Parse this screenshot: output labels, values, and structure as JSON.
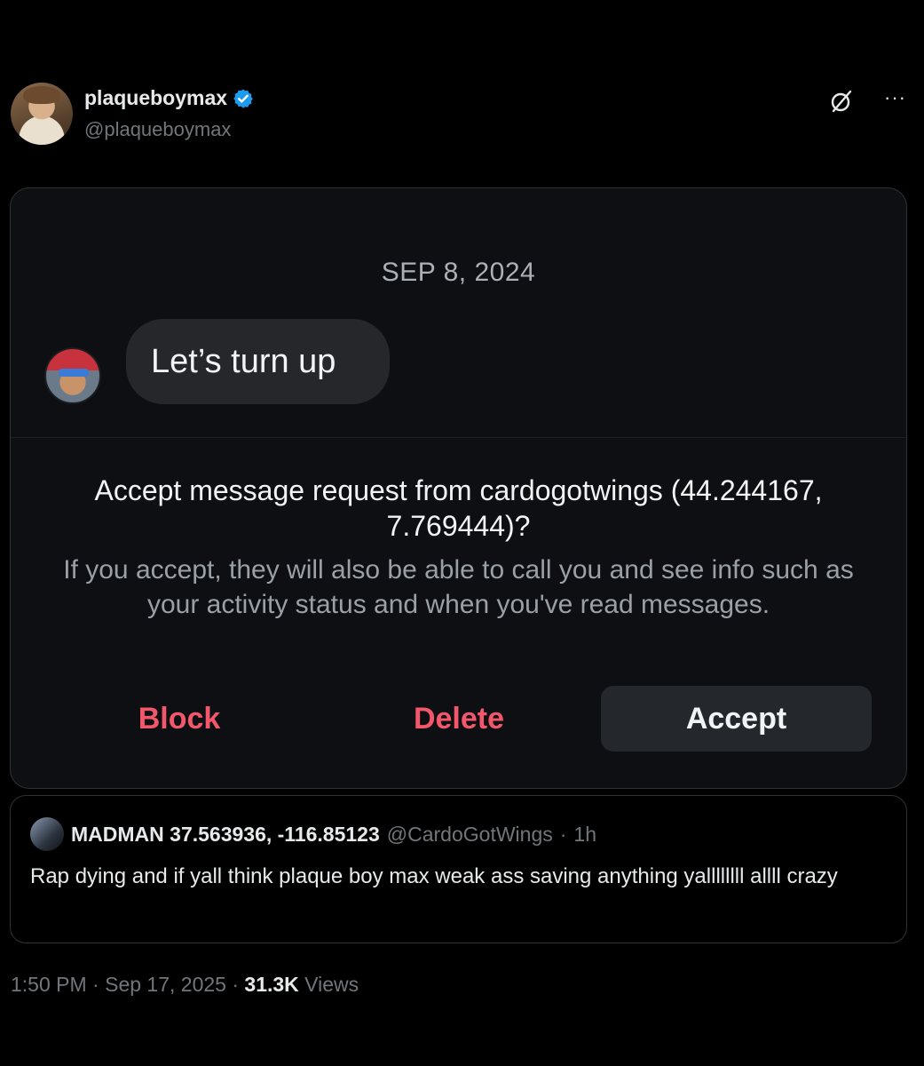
{
  "author": {
    "display_name": "plaqueboymax",
    "handle": "@plaqueboymax",
    "verified_icon": "verified-badge-icon",
    "verified_color": "#1d9bf0"
  },
  "actions": {
    "grok_icon": "grok-icon",
    "more_label": "···"
  },
  "screenshot": {
    "date": "SEP 8, 2024",
    "message": "Let’s turn up",
    "request_title": "Accept message request from cardogotwings (44.244167, 7.769444)?",
    "request_body": "If you accept, they will also be able to call you and see info such as your activity status and when you've read messages.",
    "block_label": "Block",
    "delete_label": "Delete",
    "accept_label": "Accept",
    "danger_color": "#f2576b"
  },
  "quote": {
    "name": "MADMAN 37.563936, -116.85123",
    "handle": "@CardoGotWings",
    "separator": "·",
    "time": "1h",
    "text": "Rap dying and if yall think plaque boy max weak ass saving anything yallllllll allll crazy"
  },
  "meta": {
    "time": "1:50 PM",
    "separator": "·",
    "date": "Sep 17, 2025",
    "views_count": "31.3K",
    "views_label": "Views"
  }
}
